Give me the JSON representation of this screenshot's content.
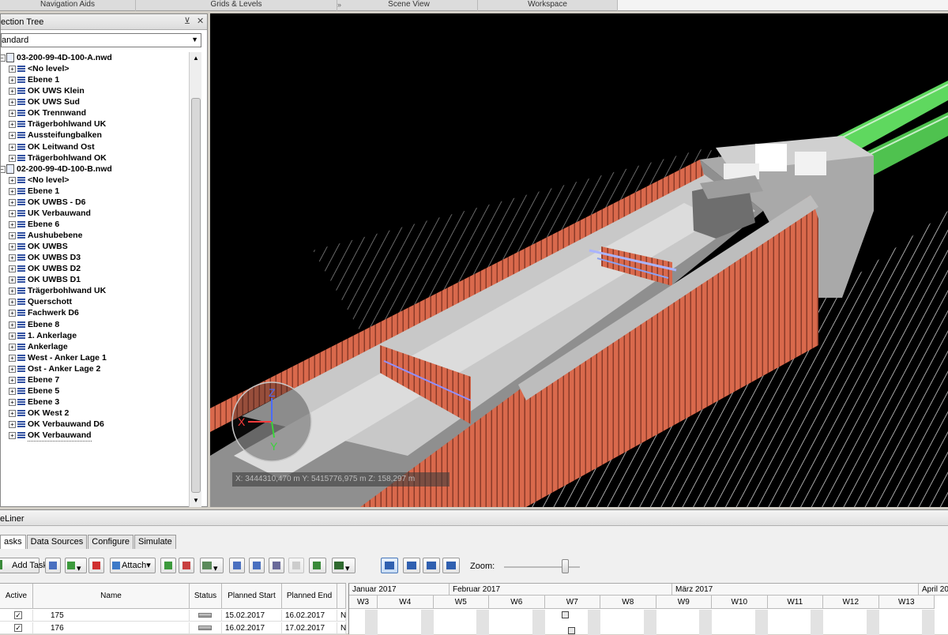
{
  "ribbon_tabs": [
    "Navigation Aids",
    "Grids & Levels",
    "Scene View",
    "Workspace"
  ],
  "selection_tree": {
    "title": "ection Tree",
    "dropdown_value": "andard",
    "items": [
      {
        "label": "03-200-99-4D-100-A.nwd",
        "type": "file"
      },
      {
        "label": "<No level>",
        "type": "layer"
      },
      {
        "label": "Ebene 1",
        "type": "layer"
      },
      {
        "label": "OK UWS Klein",
        "type": "layer"
      },
      {
        "label": "OK UWS Sud",
        "type": "layer"
      },
      {
        "label": "OK Trennwand",
        "type": "layer"
      },
      {
        "label": "Trägerbohlwand UK",
        "type": "layer"
      },
      {
        "label": "Aussteifungbalken",
        "type": "layer"
      },
      {
        "label": "OK Leitwand Ost",
        "type": "layer"
      },
      {
        "label": "Trägerbohlwand OK",
        "type": "layer"
      },
      {
        "label": "02-200-99-4D-100-B.nwd",
        "type": "file"
      },
      {
        "label": "<No level>",
        "type": "layer"
      },
      {
        "label": "Ebene 1",
        "type": "layer"
      },
      {
        "label": "OK UWBS - D6",
        "type": "layer"
      },
      {
        "label": "UK Verbauwand",
        "type": "layer"
      },
      {
        "label": "Ebene 6",
        "type": "layer"
      },
      {
        "label": "Aushubebene",
        "type": "layer"
      },
      {
        "label": "OK UWBS",
        "type": "layer"
      },
      {
        "label": "OK UWBS D3",
        "type": "layer"
      },
      {
        "label": "OK UWBS D2",
        "type": "layer"
      },
      {
        "label": "OK UWBS D1",
        "type": "layer"
      },
      {
        "label": "Trägerbohlwand UK",
        "type": "layer"
      },
      {
        "label": "Querschott",
        "type": "layer"
      },
      {
        "label": "Fachwerk D6",
        "type": "layer"
      },
      {
        "label": "Ebene 8",
        "type": "layer"
      },
      {
        "label": "1. Ankerlage",
        "type": "layer"
      },
      {
        "label": "Ankerlage",
        "type": "layer"
      },
      {
        "label": "West - Anker Lage 1",
        "type": "layer"
      },
      {
        "label": "Ost - Anker Lage 2",
        "type": "layer"
      },
      {
        "label": "Ebene 7",
        "type": "layer"
      },
      {
        "label": "Ebene 5",
        "type": "layer"
      },
      {
        "label": "Ebene 3",
        "type": "layer"
      },
      {
        "label": "OK West 2",
        "type": "layer"
      },
      {
        "label": "OK Verbauwand D6",
        "type": "layer"
      },
      {
        "label": "OK Verbauwand",
        "type": "layer"
      }
    ]
  },
  "scene": {
    "coordinates": "X: 3444310,470 m  Y: 5415776,975 m  Z: 158,297 m",
    "axis_labels": {
      "x": "X",
      "y": "Y",
      "z": "Z"
    },
    "colors": {
      "background": "#000000",
      "wall": "#d9694c",
      "slab": "#c8c8c8",
      "pipe": "#5fd85f"
    }
  },
  "timeliner": {
    "title": "eLiner",
    "tabs": [
      "asks",
      "Data Sources",
      "Configure",
      "Simulate"
    ],
    "active_tab": "asks",
    "toolbar": {
      "add_task": "Add Task",
      "attach": "Attach",
      "zoom_label": "Zoom:"
    },
    "zoom_level": 0.77,
    "columns": [
      "Active",
      "Name",
      "Status",
      "Planned Start",
      "Planned End"
    ],
    "tasks": [
      {
        "active": "✓",
        "name": "175",
        "planned_start": "15.02.2017",
        "planned_end": "16.02.2017",
        "overflow": "N"
      },
      {
        "active": "✓",
        "name": "176",
        "planned_start": "16.02.2017",
        "planned_end": "17.02.2017",
        "overflow": "N"
      }
    ],
    "months": [
      "Januar 2017",
      "Februar 2017",
      "März 2017",
      "April 20"
    ],
    "weeks": [
      "W3",
      "W4",
      "W5",
      "W6",
      "W7",
      "W8",
      "W9",
      "W10",
      "W11",
      "W12",
      "W13"
    ]
  }
}
